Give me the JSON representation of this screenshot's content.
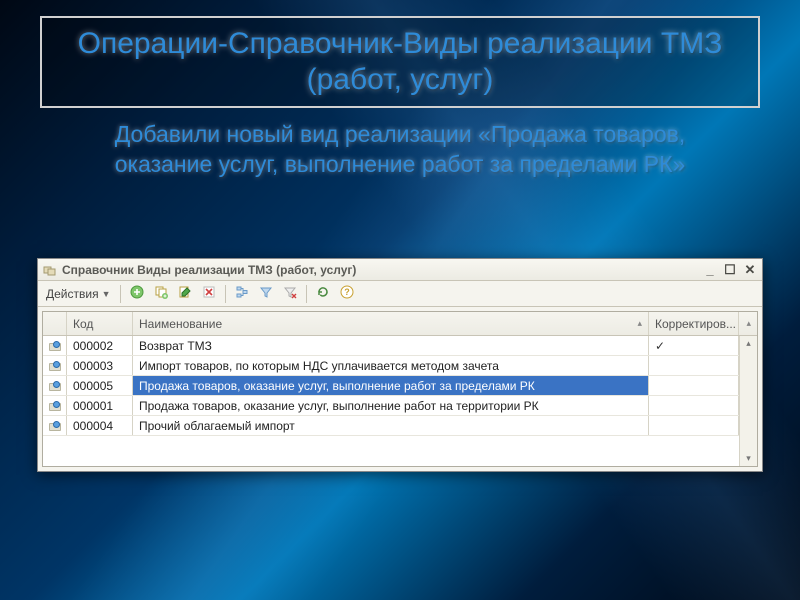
{
  "slide": {
    "title": "Операции-Справочник-Виды реализации ТМЗ (работ, услуг)",
    "subtitle": "Добавили новый вид реализации «Продажа товаров, оказание услуг, выполнение работ за пределами РК»"
  },
  "window": {
    "title": "Справочник Виды реализации ТМЗ (работ, услуг)",
    "actions_label": "Действия",
    "columns": {
      "code": "Код",
      "name": "Наименование",
      "corr": "Корректиров..."
    },
    "rows": [
      {
        "code": "000002",
        "name": "Возврат ТМЗ",
        "corr": "✓",
        "selected": false
      },
      {
        "code": "000003",
        "name": "Импорт товаров, по которым НДС уплачивается методом зачета",
        "corr": "",
        "selected": false
      },
      {
        "code": "000005",
        "name": "Продажа товаров, оказание услуг, выполнение работ за пределами РК",
        "corr": "",
        "selected": true
      },
      {
        "code": "000001",
        "name": "Продажа товаров, оказание услуг, выполнение работ на территории РК",
        "corr": "",
        "selected": false
      },
      {
        "code": "000004",
        "name": "Прочий облагаемый импорт",
        "corr": "",
        "selected": false
      }
    ]
  }
}
